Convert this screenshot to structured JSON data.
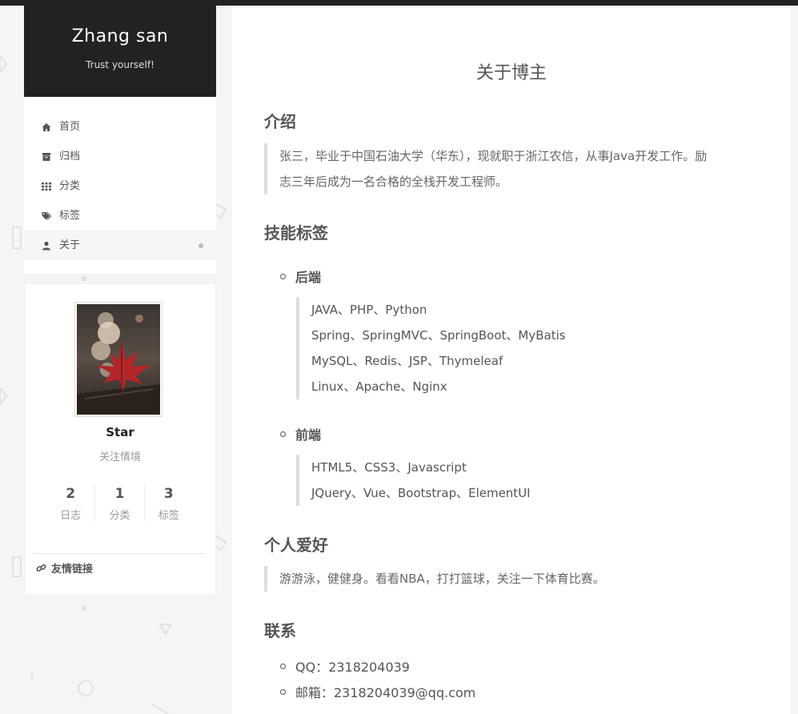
{
  "sidebar": {
    "site_title": "Zhang san",
    "site_subtitle": "Trust yourself!",
    "menu": [
      {
        "label": "首页",
        "icon": "home-icon"
      },
      {
        "label": "归档",
        "icon": "archive-icon"
      },
      {
        "label": "分类",
        "icon": "grid-icon"
      },
      {
        "label": "标签",
        "icon": "tags-icon"
      },
      {
        "label": "关于",
        "icon": "user-icon",
        "active": true
      }
    ],
    "profile": {
      "name": "Star",
      "description": "关注情境",
      "stats": [
        {
          "count": "2",
          "label": "日志"
        },
        {
          "count": "1",
          "label": "分类"
        },
        {
          "count": "3",
          "label": "标签"
        }
      ],
      "links_label": "友情链接"
    }
  },
  "main": {
    "title": "关于博主",
    "intro": {
      "heading": "介绍",
      "text_line1": "张三，毕业于中国石油大学（华东），现就职于浙江农信，从事Java开发工作。励",
      "text_line2": "志三年后成为一名合格的全栈开发工程师。"
    },
    "skills": {
      "heading": "技能标签",
      "backend_label": "后端",
      "backend": [
        "JAVA、PHP、Python",
        "Spring、SpringMVC、SpringBoot、MyBatis",
        "MySQL、Redis、JSP、Thymeleaf",
        "Linux、Apache、Nginx"
      ],
      "frontend_label": "前端",
      "frontend": [
        "HTML5、CSS3、Javascript",
        "JQuery、Vue、Bootstrap、ElementUI"
      ]
    },
    "hobby": {
      "heading": "个人爱好",
      "text": "游游泳，健健身。看看NBA，打打篮球，关注一下体育比赛。"
    },
    "contact": {
      "heading": "联系",
      "qq": "QQ：2318204039",
      "email": "邮箱：2318204039@qq.com"
    }
  },
  "colors": {
    "dark": "#222222",
    "text": "#555555",
    "border": "#dddddd"
  }
}
